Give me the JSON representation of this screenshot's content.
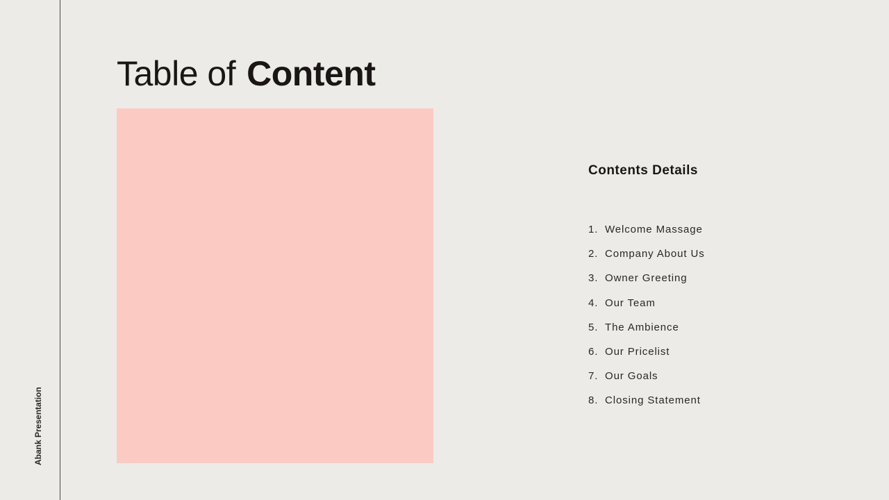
{
  "sidebar": {
    "label": "Abank Presentation"
  },
  "title": {
    "light": "Table of",
    "bold": "Content"
  },
  "image_placeholder": {
    "color": "#fbcbc3"
  },
  "contents": {
    "heading": "Contents Details",
    "items": [
      {
        "num": "1.",
        "label": "Welcome Massage"
      },
      {
        "num": "2.",
        "label": "Company About Us"
      },
      {
        "num": "3.",
        "label": "Owner Greeting"
      },
      {
        "num": "4.",
        "label": "Our Team"
      },
      {
        "num": "5.",
        "label": "The Ambience"
      },
      {
        "num": "6.",
        "label": "Our Pricelist"
      },
      {
        "num": "7.",
        "label": "Our Goals"
      },
      {
        "num": "8.",
        "label": "Closing Statement"
      }
    ]
  }
}
